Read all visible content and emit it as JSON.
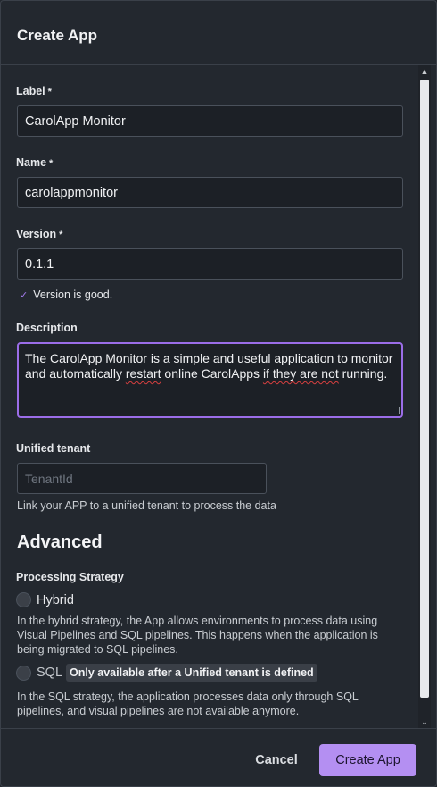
{
  "dialog": {
    "title": "Create App"
  },
  "form": {
    "label": {
      "label": "Label",
      "required": "*",
      "value": "CarolApp Monitor"
    },
    "name": {
      "label": "Name",
      "required": "*",
      "value": "carolappmonitor"
    },
    "version": {
      "label": "Version",
      "required": "*",
      "value": "0.1.1",
      "validation": "Version is good."
    },
    "description": {
      "label": "Description",
      "text_1": "The CarolApp Monitor is a simple and useful application to monitor and automatically ",
      "text_misspelled_1": "restart",
      "text_2": " online CarolApps ",
      "text_misspelled_2": "if they are not",
      "text_3": " running."
    },
    "tenant": {
      "label": "Unified tenant",
      "placeholder": "TenantId",
      "help": "Link your APP to a unified tenant to process the data"
    }
  },
  "advanced": {
    "heading": "Advanced",
    "strategy_label": "Processing Strategy",
    "hybrid": {
      "label": "Hybrid",
      "help": "In the hybrid strategy, the App allows environments to process data using Visual Pipelines and SQL pipelines. This happens when the application is being migrated to SQL pipelines."
    },
    "sql": {
      "label": "SQL",
      "badge": "Only available after a Unified tenant is defined",
      "help": "In the SQL strategy, the application processes data only through SQL pipelines, and visual pipelines are not available anymore."
    }
  },
  "footer": {
    "cancel": "Cancel",
    "create": "Create App"
  },
  "colors": {
    "accent": "#b48ff2",
    "focus_border": "#9b6de8",
    "background": "#23282f"
  }
}
